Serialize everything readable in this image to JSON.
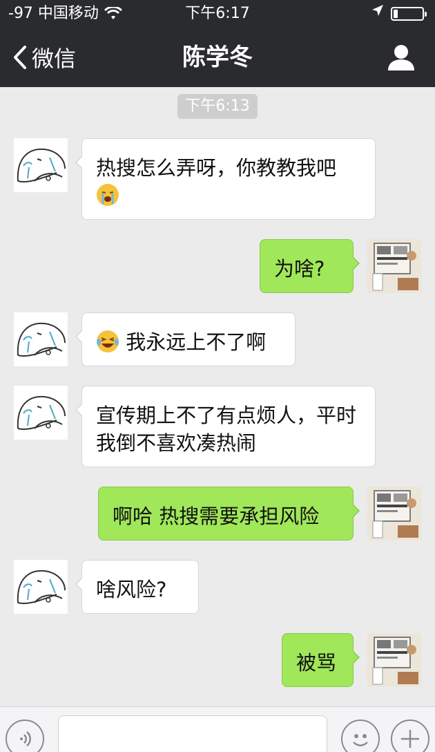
{
  "status_bar": {
    "carrier": "-97 中国移动",
    "time": "下午6:17"
  },
  "nav": {
    "back_label": "微信",
    "title": "陈学冬"
  },
  "chat": {
    "timestamp": "下午6:13",
    "messages": [
      {
        "side": "in",
        "text": "热搜怎么弄呀，你教教我吧",
        "emoji": "crying-face-icon"
      },
      {
        "side": "out",
        "text": "为啥?"
      },
      {
        "side": "in",
        "emoji": "laughing-tears-icon",
        "text": "我永远上不了啊"
      },
      {
        "side": "in",
        "text": "宣传期上不了有点烦人，平时我倒不喜欢凑热闹"
      },
      {
        "side": "out",
        "text": "啊哈 热搜需要承担风险"
      },
      {
        "side": "in",
        "text": "啥风险?"
      },
      {
        "side": "out",
        "text": "被骂"
      }
    ]
  },
  "input_bar": {
    "voice_icon": "voice-icon",
    "emoji_icon": "smiley-icon",
    "plus_icon": "plus-icon"
  },
  "colors": {
    "nav_bg": "#2a2b2f",
    "chat_bg": "#ebebeb",
    "outgoing_bubble": "#a0e75a",
    "incoming_bubble": "#ffffff"
  }
}
